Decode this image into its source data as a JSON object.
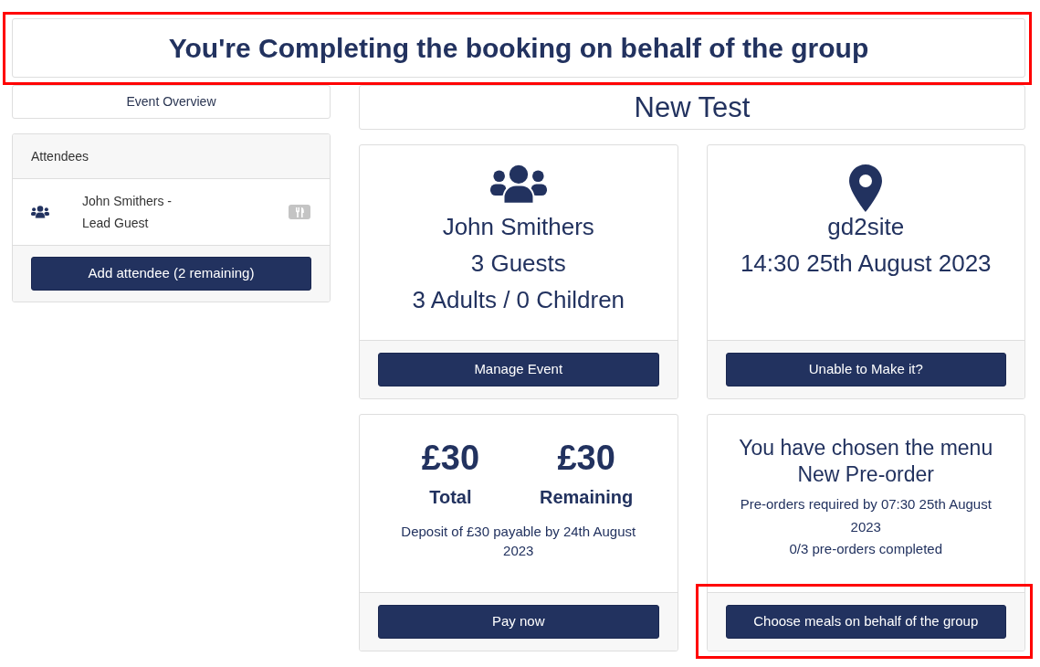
{
  "banner": {
    "title": "You're Completing the booking on behalf of the group",
    "highlighted": true
  },
  "sidebar": {
    "overview_link": "Event Overview",
    "attendees_panel": {
      "title": "Attendees",
      "attendees": [
        {
          "name": "John Smithers - Lead Guest"
        }
      ],
      "add_button": "Add attendee (2 remaining)"
    }
  },
  "event": {
    "title": "New Test"
  },
  "cards": [
    {
      "kind": "host",
      "lines": [
        "John Smithers",
        "3 Guests",
        "3 Adults / 0 Children"
      ],
      "button": {
        "label": "Manage Event",
        "highlighted": false
      }
    },
    {
      "kind": "venue",
      "lines": [
        "gd2site",
        "14:30 25th August 2023"
      ],
      "button": {
        "label": "Unable to Make it?",
        "highlighted": false
      }
    },
    {
      "kind": "payment",
      "amounts": [
        {
          "value": "£30",
          "label": "Total"
        },
        {
          "value": "£30",
          "label": "Remaining"
        }
      ],
      "note": "Deposit of £30 payable by 24th August 2023",
      "button": {
        "label": "Pay now",
        "highlighted": false
      }
    },
    {
      "kind": "menu",
      "heading": "You have chosen the menu New Pre-order",
      "notes": [
        "Pre-orders required by 07:30 25th August 2023",
        "0/3 pre-orders completed"
      ],
      "button": {
        "label": "Choose meals on behalf of the group",
        "highlighted": true
      }
    }
  ]
}
